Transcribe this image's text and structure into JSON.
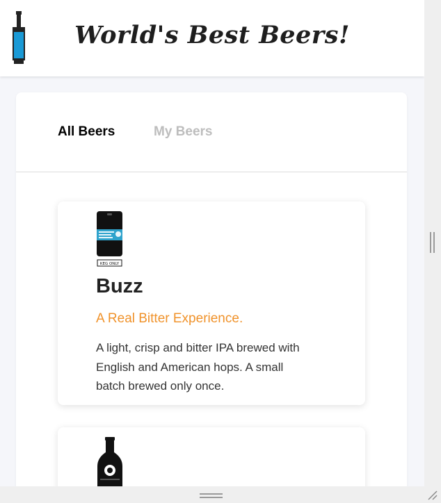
{
  "header": {
    "title": "World's Best Beers!",
    "logo_icon": "beer-bottle-icon"
  },
  "tabs": [
    {
      "label": "All Beers",
      "active": true
    },
    {
      "label": "My Beers",
      "active": false
    }
  ],
  "beers": [
    {
      "name": "Buzz",
      "tagline": "A Real Bitter Experience.",
      "description": "A light, crisp and bitter IPA brewed with English and American hops. A small batch brewed only once.",
      "image_icon": "keg-icon",
      "image_label": "KEG ONLY"
    },
    {
      "image_icon": "beer-bottle-icon"
    }
  ],
  "colors": {
    "accent": "#f0922a",
    "bottle_blue": "#1a9ad6",
    "active_tab": "#000000",
    "inactive_tab": "#bdbdbd"
  }
}
